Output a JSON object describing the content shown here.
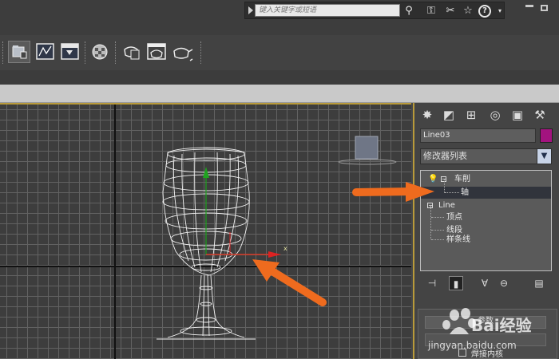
{
  "top_bar": {
    "search_placeholder": "键入关键字或短语"
  },
  "command_panel": {
    "object_name": "Line03",
    "object_color": "#a3137f",
    "modifier_list_label": "修改器列表",
    "stack": {
      "lathe_label": "车削",
      "axis_label": "轴",
      "line_label": "Line",
      "vertex_label": "顶点",
      "segment_label": "线段",
      "spline_label": "样条线"
    },
    "rollout": {
      "title": "参数",
      "weld_core_label": "焊接内核"
    }
  },
  "watermark": {
    "text_1": "Bai经验",
    "text_2": "jingyan.baidu.com"
  },
  "colors": {
    "viewport_border": "#b99a3a",
    "annotation_arrow": "#ef6b1e"
  }
}
